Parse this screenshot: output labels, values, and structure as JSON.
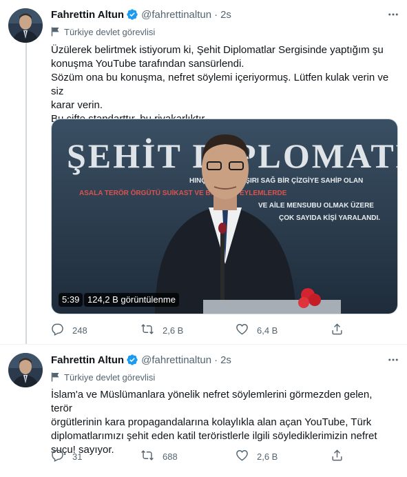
{
  "tweets": [
    {
      "author_name": "Fahrettin Altun",
      "handle": "@fahrettinaltun",
      "separator": "·",
      "time": "2s",
      "label": "Türkiye devlet görevlisi",
      "text_lines": [
        "Üzülerek belirtmek istiyorum ki, Şehit Diplomatlar Sergisinde yaptığım şu",
        "konuşma YouTube tarafından sansürlendi.",
        "Sözüm ona bu konuşma, nefret söylemi içeriyormuş. Lütfen kulak verin ve siz",
        "karar verin.",
        "Bu çifte standarttır, bu riyakarlıktır."
      ],
      "media": {
        "banner_title": "ŞEHİT DİPLOMATLAR",
        "banner_lines": [
          "HINÇAK YAKIN AŞIRI SAĞ BİR ÇİZGİYE SAHİP OLAN",
          "ASALA TERÖR ÖRGÜTÜ SUİKAST VE BOMBALI EYLEMLERDE",
          "VE AİLE MENSUBU OLMAK ÜZERE",
          "ÇOK SAYIDA KİŞİ YARALANDI."
        ],
        "duration": "5:39",
        "views": "124,2 B görüntülenme"
      },
      "actions": {
        "replies": "248",
        "retweets": "2,6 B",
        "likes": "6,4 B"
      }
    },
    {
      "author_name": "Fahrettin Altun",
      "handle": "@fahrettinaltun",
      "separator": "·",
      "time": "2s",
      "label": "Türkiye devlet görevlisi",
      "text_lines": [
        "İslam'a ve Müslümanlara yönelik nefret söylemlerini görmezden gelen, terör",
        "örgütlerinin kara propagandalarına kolaylıkla alan açan YouTube, Türk",
        "diplomatlarımızı şehit eden katil teröristlerle ilgili söylediklerimizin nefret",
        "suçu! sayıyor."
      ],
      "actions": {
        "replies": "31",
        "retweets": "688",
        "likes": "2,6 B"
      }
    }
  ],
  "colors": {
    "text": "#0f1419",
    "secondary": "#536471",
    "verified": "#1d9bf0",
    "divider": "#eff3f4"
  },
  "icons": [
    "more-icon",
    "flag-icon",
    "verified-icon",
    "reply-icon",
    "retweet-icon",
    "like-icon",
    "share-icon"
  ]
}
